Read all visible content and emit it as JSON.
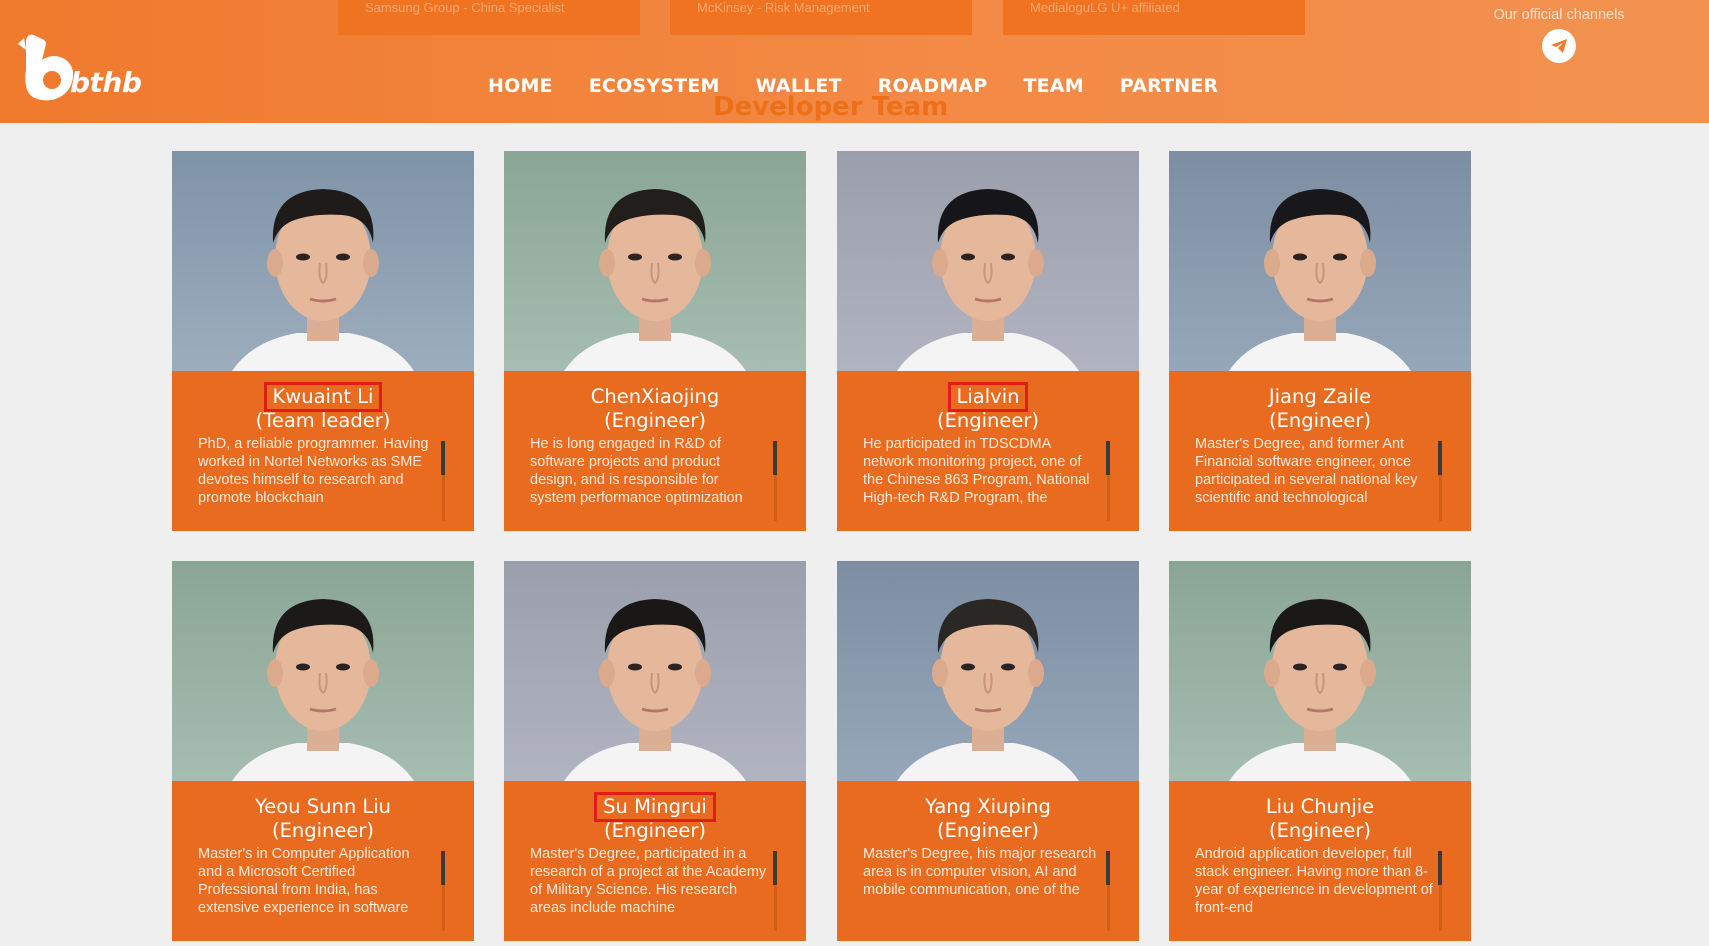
{
  "top_cards": [
    {
      "text": "Samsung Group - China Specialist"
    },
    {
      "text": "McKinsey - Risk Management"
    },
    {
      "text": "MedialoguLG U+ affiliated"
    }
  ],
  "logo": {
    "text": "bthb"
  },
  "nav": [
    "HOME",
    "ECOSYSTEM",
    "WALLET",
    "ROADMAP",
    "TEAM",
    "PARTNER"
  ],
  "channels": {
    "label": "Our official channels",
    "icon": "telegram-icon"
  },
  "section_title": "Developer Team",
  "colors": {
    "brand": "#e86b1f",
    "header": "#f38a45",
    "highlight": "#e21c1c"
  },
  "team": [
    {
      "name": "Kwuaint Li",
      "role": "(Team leader)",
      "desc": "PhD, a reliable programmer. Having worked in Nortel Networks as SME devotes himself to research and promote blockchain",
      "highlight": true
    },
    {
      "name": "ChenXiaojing",
      "role": "(Engineer)",
      "desc": "He is long engaged in R&D of software projects and product design, and is responsible for system performance optimization",
      "highlight": false
    },
    {
      "name": "Lialvin",
      "role": "(Engineer)",
      "desc": "He participated in TDSCDMA network monitoring project, one of the Chinese 863 Program, National High-tech R&D Program, the",
      "highlight": true
    },
    {
      "name": "Jiang Zaile",
      "role": "(Engineer)",
      "desc": "Master's Degree, and former Ant Financial software engineer, once participated in several national key scientific and technological",
      "highlight": false
    },
    {
      "name": "Yeou Sunn Liu",
      "role": "(Engineer)",
      "desc": "Master's in Computer Application and a Microsoft Certified Professional from India, has extensive experience in software",
      "highlight": false
    },
    {
      "name": "Su Mingrui",
      "role": "(Engineer)",
      "desc": "Master's Degree, participated in a research of a project at the Academy of Military Science. His research areas include machine",
      "highlight": true
    },
    {
      "name": "Yang Xiuping",
      "role": "(Engineer)",
      "desc": "Master's Degree, his major research area is in computer vision, AI and mobile communication, one of the",
      "highlight": false
    },
    {
      "name": "Liu Chunjie",
      "role": "(Engineer)",
      "desc": "Android application developer, full stack engineer. Having more than 8-year of experience in development of front-end",
      "highlight": false
    }
  ]
}
